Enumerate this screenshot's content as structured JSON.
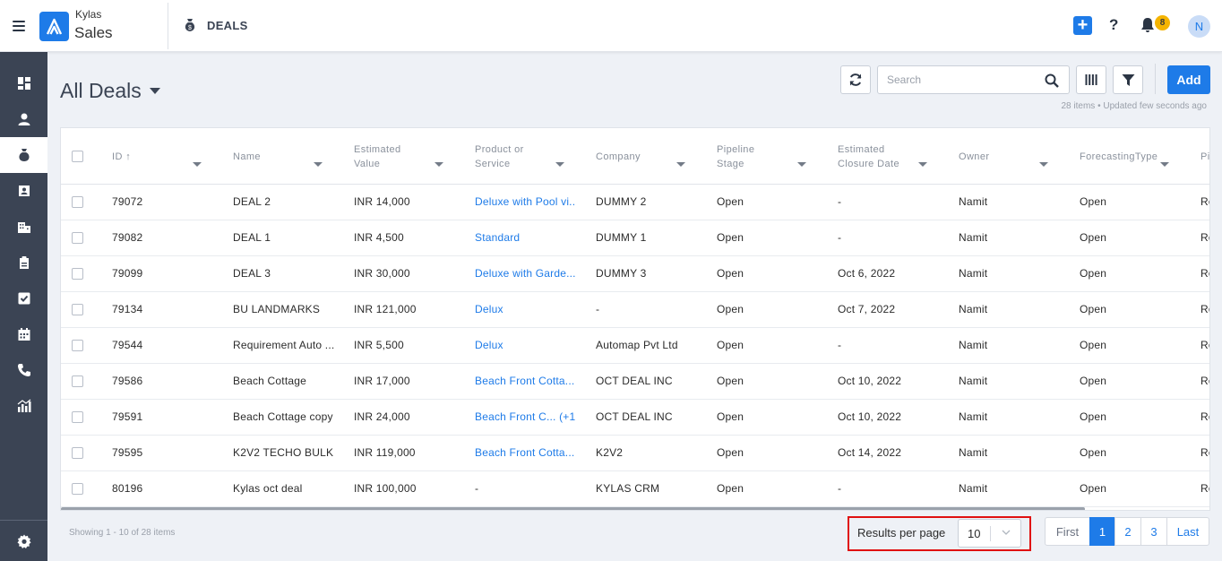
{
  "app": {
    "brand_top": "Kylas",
    "brand_bottom": "Sales",
    "module": "DEALS",
    "notification_count": "8",
    "avatar_initial": "N"
  },
  "colors": {
    "accent": "#1e7be8",
    "sidebar": "#3b4454",
    "highlight_border": "#e01010",
    "badge": "#f5b400"
  },
  "sidebar": {
    "items": [
      {
        "icon": "dashboard-icon"
      },
      {
        "icon": "contacts-icon"
      },
      {
        "icon": "deals-moneybag-icon",
        "active": true
      },
      {
        "icon": "contact-card-icon"
      },
      {
        "icon": "company-building-icon"
      },
      {
        "icon": "clipboard-icon"
      },
      {
        "icon": "tasks-check-icon"
      },
      {
        "icon": "calendar-icon"
      },
      {
        "icon": "phone-icon"
      },
      {
        "icon": "reports-chart-icon"
      }
    ],
    "settings_icon": "gear-icon"
  },
  "header": {
    "title": "All Deals",
    "search_placeholder": "Search",
    "add_label": "Add",
    "items_meta": "28 items • Updated few seconds ago"
  },
  "table": {
    "columns": [
      {
        "label": "ID ↑"
      },
      {
        "label": "Name"
      },
      {
        "label": "Estimated Value"
      },
      {
        "label": "Product or Service"
      },
      {
        "label": "Company"
      },
      {
        "label": "Pipeline Stage"
      },
      {
        "label": "Estimated Closure Date"
      },
      {
        "label": "Owner"
      },
      {
        "label": "ForecastingType"
      },
      {
        "label": "Pi"
      }
    ],
    "rows": [
      {
        "id": "79072",
        "name": "DEAL 2",
        "value": "INR 14,000",
        "product": "Deluxe with Pool vi...",
        "company": "DUMMY 2",
        "stage": "Open",
        "closure": "-",
        "owner": "Namit",
        "forecast": "Open",
        "extra": "Ro"
      },
      {
        "id": "79082",
        "name": "DEAL 1",
        "value": "INR 4,500",
        "product": "Standard",
        "company": "DUMMY 1",
        "stage": "Open",
        "closure": "-",
        "owner": "Namit",
        "forecast": "Open",
        "extra": "Ro"
      },
      {
        "id": "79099",
        "name": "DEAL 3",
        "value": "INR 30,000",
        "product": "Deluxe with Garde...",
        "company": "DUMMY 3",
        "stage": "Open",
        "closure": "Oct 6, 2022",
        "owner": "Namit",
        "forecast": "Open",
        "extra": "Ro"
      },
      {
        "id": "79134",
        "name": "BU LANDMARKS",
        "value": "INR 121,000",
        "product": "Delux",
        "company": "-",
        "stage": "Open",
        "closure": "Oct 7, 2022",
        "owner": "Namit",
        "forecast": "Open",
        "extra": "Ro"
      },
      {
        "id": "79544",
        "name": "Requirement Auto ...",
        "value": "INR 5,500",
        "product": "Delux",
        "company": "Automap Pvt Ltd",
        "stage": "Open",
        "closure": "-",
        "owner": "Namit",
        "forecast": "Open",
        "extra": "Ro"
      },
      {
        "id": "79586",
        "name": "Beach Cottage",
        "value": "INR 17,000",
        "product": "Beach Front Cotta...",
        "company": "OCT DEAL INC",
        "stage": "Open",
        "closure": "Oct 10, 2022",
        "owner": "Namit",
        "forecast": "Open",
        "extra": "Ro"
      },
      {
        "id": "79591",
        "name": "Beach Cottage copy",
        "value": "INR 24,000",
        "product": "Beach Front C...  (+1)",
        "company": "OCT DEAL INC",
        "stage": "Open",
        "closure": "Oct 10, 2022",
        "owner": "Namit",
        "forecast": "Open",
        "extra": "Ro"
      },
      {
        "id": "79595",
        "name": "K2V2 TECHO BULK",
        "value": "INR 119,000",
        "product": "Beach Front Cotta...",
        "company": "K2V2",
        "stage": "Open",
        "closure": "Oct 14, 2022",
        "owner": "Namit",
        "forecast": "Open",
        "extra": "Ro"
      },
      {
        "id": "80196",
        "name": "Kylas oct deal",
        "value": "INR 100,000",
        "product": "-",
        "company": "KYLAS CRM",
        "stage": "Open",
        "closure": "-",
        "owner": "Namit",
        "forecast": "Open",
        "extra": "Ro"
      }
    ]
  },
  "footer": {
    "showing": "Showing 1 - 10 of 28 items",
    "results_per_page_label": "Results per page",
    "results_per_page_value": "10",
    "pages": [
      "First",
      "1",
      "2",
      "3",
      "Last"
    ],
    "active_page": "1"
  }
}
